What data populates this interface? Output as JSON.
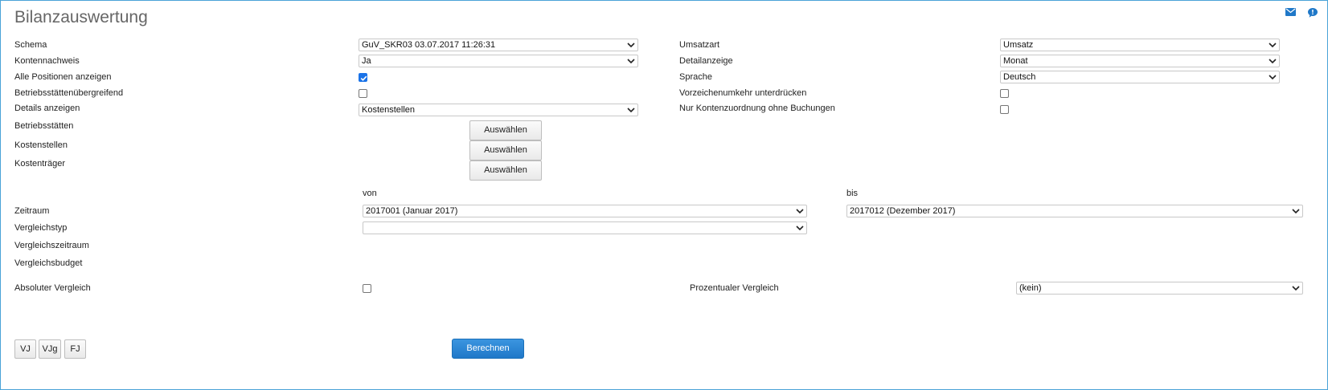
{
  "title": "Bilanzauswertung",
  "icons": {
    "mail": "mail-icon",
    "help": "help-icon"
  },
  "left": {
    "schema": {
      "label": "Schema",
      "value": "GuV_SKR03 03.07.2017 11:26:31"
    },
    "kontennachweis": {
      "label": "Kontennachweis",
      "value": "Ja"
    },
    "alle_positionen": {
      "label": "Alle Positionen anzeigen",
      "checked": true
    },
    "betriebsstaetten_uebergreifend": {
      "label": "Betriebsstättenübergreifend",
      "checked": false
    },
    "details": {
      "label": "Details anzeigen",
      "value": "Kostenstellen"
    },
    "betriebsstaetten": {
      "label": "Betriebsstätten",
      "button": "Auswählen"
    },
    "kostenstellen": {
      "label": "Kostenstellen",
      "button": "Auswählen"
    },
    "kostentraeger": {
      "label": "Kostenträger",
      "button": "Auswählen"
    }
  },
  "right": {
    "umsatzart": {
      "label": "Umsatzart",
      "value": "Umsatz"
    },
    "detailanzeige": {
      "label": "Detailanzeige",
      "value": "Monat"
    },
    "sprache": {
      "label": "Sprache",
      "value": "Deutsch"
    },
    "vorzeichen": {
      "label": "Vorzeichenumkehr unterdrücken",
      "checked": false
    },
    "nur_konten": {
      "label": "Nur Kontenzuordnung ohne Buchungen",
      "checked": false
    }
  },
  "period": {
    "von_label": "von",
    "bis_label": "bis",
    "zeitraum_label": "Zeitraum",
    "von_value": "2017001 (Januar 2017)",
    "bis_value": "2017012 (Dezember 2017)",
    "vergleichstyp_label": "Vergleichstyp",
    "vergleichstyp_value": "",
    "vergleichszeitraum_label": "Vergleichszeitraum",
    "vergleichsbudget_label": "Vergleichsbudget"
  },
  "compare": {
    "absolut_label": "Absoluter Vergleich",
    "absolut_checked": false,
    "prozentual_label": "Prozentualer Vergleich",
    "prozentual_value": "(kein)"
  },
  "footer": {
    "vj": "VJ",
    "vjg": "VJg",
    "fj": "FJ",
    "berechnen": "Berechnen"
  },
  "colors": {
    "accent": "#1f78c8",
    "border": "#4aa3d8",
    "checkbox": "#1a73e8"
  }
}
